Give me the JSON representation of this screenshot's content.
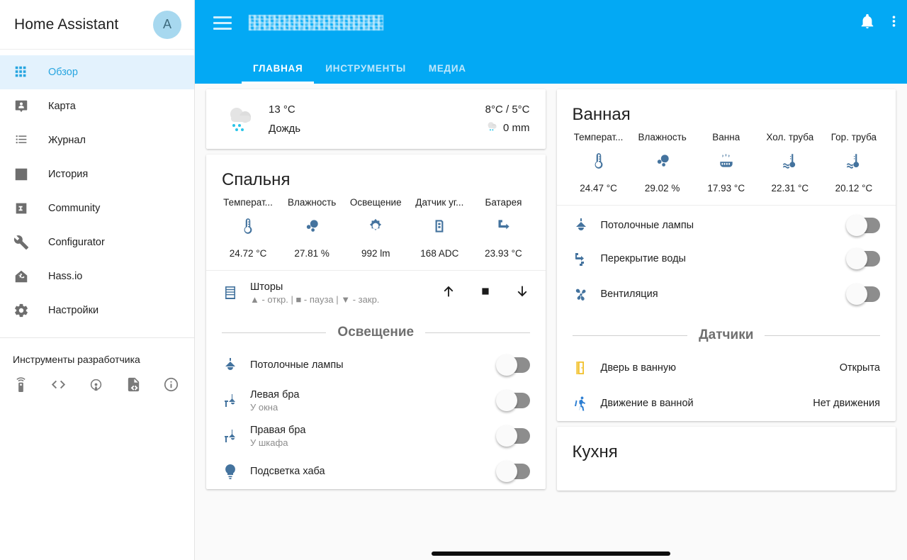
{
  "sidebar": {
    "title": "Home Assistant",
    "avatar_initial": "A",
    "items": [
      {
        "label": "Обзор",
        "icon": "grid-icon",
        "active": true
      },
      {
        "label": "Карта",
        "icon": "map-marker-account-icon",
        "active": false
      },
      {
        "label": "Журнал",
        "icon": "format-list-bulleted-icon",
        "active": false
      },
      {
        "label": "История",
        "icon": "chart-bar-icon",
        "active": false
      },
      {
        "label": "Community",
        "icon": "community-icon",
        "active": false
      },
      {
        "label": "Configurator",
        "icon": "wrench-icon",
        "active": false
      },
      {
        "label": "Hass.io",
        "icon": "hassio-home-icon",
        "active": false
      },
      {
        "label": "Настройки",
        "icon": "gear-icon",
        "active": false
      }
    ],
    "developer_tools_label": "Инструменты разработчика",
    "developer_tools_icons": [
      "remote-icon",
      "code-tags-icon",
      "broadcast-icon",
      "file-code-icon",
      "information-icon"
    ]
  },
  "appbar": {
    "menu_icon": "hamburger-icon",
    "title": "",
    "notification_icon": "bell-icon",
    "overflow_icon": "dots-vertical-icon",
    "accent_color": "#03a9f4",
    "tabs": [
      {
        "label": "ГЛАВНАЯ",
        "active": true
      },
      {
        "label": "ИНСТРУМЕНТЫ",
        "active": false
      },
      {
        "label": "МЕДИА",
        "active": false
      }
    ]
  },
  "weather": {
    "icon": "rainy-icon",
    "temperature": "13 °C",
    "condition": "Дождь",
    "high_low": "8°C / 5°C",
    "precip_icon": "rainy-small-icon",
    "precipitation": "0 mm"
  },
  "bedroom": {
    "title": "Спальня",
    "sensors": [
      {
        "name": "Температ...",
        "icon": "thermometer-icon",
        "value": "24.72 °C"
      },
      {
        "name": "Влажность",
        "icon": "water-percent-icon",
        "value": "27.81 %"
      },
      {
        "name": "Освещение",
        "icon": "brightness-icon",
        "value": "992 lm"
      },
      {
        "name": "Датчик уг...",
        "icon": "gas-canister-icon",
        "value": "168 ADC"
      },
      {
        "name": "Батарея",
        "icon": "pipe-icon",
        "value": "23.93 °C"
      }
    ],
    "cover": {
      "icon": "blinds-icon",
      "name": "Шторы",
      "hint": "▲ - откр. | ■ - пауза | ▼ - закр.",
      "buttons": [
        "arrow-up-icon",
        "stop-square-icon",
        "arrow-down-icon"
      ]
    },
    "section_lighting": "Освещение",
    "lights": [
      {
        "icon": "ceiling-light-icon",
        "name": "Потолочные лампы",
        "sub": "",
        "state": "off"
      },
      {
        "icon": "wall-sconce-icon",
        "name": "Левая бра",
        "sub": "У окна",
        "state": "off"
      },
      {
        "icon": "wall-sconce-icon",
        "name": "Правая бра",
        "sub": "У шкафа",
        "state": "off"
      },
      {
        "icon": "lightbulb-icon",
        "name": "Подсветка хаба",
        "sub": "",
        "state": "off"
      }
    ]
  },
  "bathroom": {
    "title": "Ванная",
    "sensors": [
      {
        "name": "Температ...",
        "icon": "thermometer-icon",
        "value": "24.47 °C"
      },
      {
        "name": "Влажность",
        "icon": "water-percent-icon",
        "value": "29.02 %"
      },
      {
        "name": "Ванна",
        "icon": "hot-tub-icon",
        "value": "17.93 °C"
      },
      {
        "name": "Хол. труба",
        "icon": "water-thermometer-icon",
        "value": "22.31 °C"
      },
      {
        "name": "Гор. труба",
        "icon": "water-thermometer-icon",
        "value": "20.12 °C"
      }
    ],
    "switches": [
      {
        "icon": "ceiling-light-icon",
        "name": "Потолочные лампы",
        "state": "off"
      },
      {
        "icon": "pipe-valve-icon",
        "name": "Перекрытие воды",
        "state": "off"
      },
      {
        "icon": "fan-icon",
        "name": "Вентиляция",
        "state": "off"
      }
    ],
    "section_sensors": "Датчики",
    "binary_sensors": [
      {
        "icon": "door-open-icon",
        "name": "Дверь в ванную",
        "state": "Открыта"
      },
      {
        "icon": "motion-walk-icon",
        "name": "Движение в ванной",
        "state": "Нет движения"
      }
    ]
  },
  "kitchen": {
    "title": "Кухня"
  }
}
